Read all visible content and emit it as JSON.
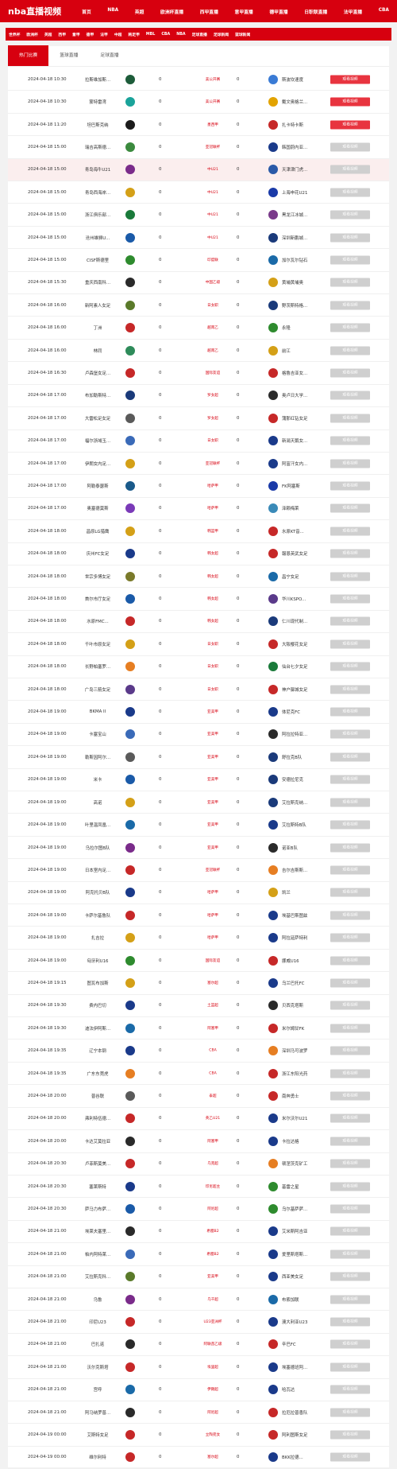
{
  "site": {
    "logo": "nba直播视频"
  },
  "topnav": [
    "首页",
    "NBA",
    "英超",
    "欧洲杯直播",
    "西甲直播",
    "意甲直播",
    "德甲直播",
    "日职联直播",
    "法甲直播",
    "CBA"
  ],
  "subnav": [
    "世界杯",
    "欧洲杯",
    "英超",
    "西甲",
    "意甲",
    "德甲",
    "法甲",
    "中超",
    "韩足甲",
    "MBL",
    "CBA",
    "NBA",
    "足球直播",
    "足球新闻",
    "篮球新闻"
  ],
  "tabs": [
    "热门比赛",
    "篮球直播",
    "足球直播"
  ],
  "colors": {
    "brand": "#d7000f",
    "live_button": "#e8343f",
    "disabled_button": "#cfcfcf"
  },
  "matches": [
    {
      "time": "2024-04-18 10:30",
      "home": "拉斯维加斯...",
      "home_score": "0",
      "league": "美公开赛",
      "away_score": "0",
      "away": "斯波坎速度",
      "button": "观看视频",
      "live": true,
      "hc": "#1d5c3a",
      "ac": "#3a7bd5"
    },
    {
      "time": "2024-04-18 10:30",
      "home": "蒙特雷湾",
      "home_score": "0",
      "league": "美公开赛",
      "away_score": "0",
      "away": "戴文奥格兰...",
      "button": "观看视频",
      "live": true,
      "hc": "#1aa39a",
      "ac": "#e2a300"
    },
    {
      "time": "2024-04-18 11:20",
      "home": "坦巴斯克纳",
      "home_score": "0",
      "league": "墨西甲",
      "away_score": "0",
      "away": "扎卡特卡斯",
      "button": "观看视频",
      "live": true,
      "hc": "#1b1b1b",
      "ac": "#c62828"
    },
    {
      "time": "2024-04-18 15:00",
      "home": "瑞吉高斯德...",
      "home_score": "0",
      "league": "亚冠联杯",
      "away_score": "0",
      "away": "韩国蔚内亚...",
      "button": "观看视频",
      "live": false,
      "hc": "#3b8a3e",
      "ac": "#1a3a8a"
    },
    {
      "time": "2024-04-18 15:00",
      "home": "青岛海牛U21",
      "home_score": "0",
      "league": "中U21",
      "away_score": "0",
      "away": "天津津门虎...",
      "button": "观看视频",
      "live": false,
      "hc": "#7a2b8a",
      "ac": "#2a5aa8",
      "hl": true
    },
    {
      "time": "2024-04-18 15:00",
      "home": "青岛西海岸...",
      "home_score": "0",
      "league": "中U21",
      "away_score": "0",
      "away": "上海申花U21",
      "button": "观看视频",
      "live": false,
      "hc": "#d4a017",
      "ac": "#1a3aa8"
    },
    {
      "time": "2024-04-18 15:00",
      "home": "浙江俱乐部...",
      "home_score": "0",
      "league": "中U21",
      "away_score": "0",
      "away": "黑龙江冰城...",
      "button": "观看视频",
      "live": false,
      "hc": "#1a7a3a",
      "ac": "#7a3a8a"
    },
    {
      "time": "2024-04-18 15:00",
      "home": "沧州雄狮U...",
      "home_score": "0",
      "league": "中U21",
      "away_score": "0",
      "away": "深圳新鹏城...",
      "button": "观看视频",
      "live": false,
      "hc": "#1a5aa8",
      "ac": "#1a3a7a"
    },
    {
      "time": "2024-04-18 15:00",
      "home": "CISF斯德里",
      "home_score": "0",
      "league": "印度联",
      "away_score": "0",
      "away": "加尔瓦尔钻石",
      "button": "观看视频",
      "live": false,
      "hc": "#2e8b2e",
      "ac": "#1a6aa8"
    },
    {
      "time": "2024-04-18 15:30",
      "home": "重庆西南科...",
      "home_score": "0",
      "league": "中国乙级",
      "away_score": "0",
      "away": "黄埔黄埔奥",
      "button": "观看视频",
      "live": false,
      "hc": "#2a2a2a",
      "ac": "#d4a017"
    },
    {
      "time": "2024-04-18 16:00",
      "home": "新阿素人女足",
      "home_score": "0",
      "league": "日女职",
      "away_score": "0",
      "away": "野茨斯特格...",
      "button": "观看视频",
      "live": false,
      "hc": "#5a7a2a",
      "ac": "#1a3a7a"
    },
    {
      "time": "2024-04-18 16:00",
      "home": "丁洲",
      "home_score": "0",
      "league": "越南乙",
      "away_score": "0",
      "away": "永隆",
      "button": "观看视频",
      "live": false,
      "hc": "#c62828",
      "ac": "#2e8b2e"
    },
    {
      "time": "2024-04-18 16:00",
      "home": "林同",
      "home_score": "0",
      "league": "越南乙",
      "away_score": "0",
      "away": "前江",
      "button": "观看视频",
      "live": false,
      "hc": "#2e8b5a",
      "ac": "#d4a017"
    },
    {
      "time": "2024-04-18 16:30",
      "home": "卢森堡女足...",
      "home_score": "0",
      "league": "国际友谊",
      "away_score": "0",
      "away": "格鲁吉亚女...",
      "button": "观看视频",
      "live": false,
      "hc": "#c62828",
      "ac": "#c62828"
    },
    {
      "time": "2024-04-18 17:00",
      "home": "布加勒斯特...",
      "home_score": "0",
      "league": "罗女超",
      "away_score": "0",
      "away": "奥卢日大学...",
      "button": "观看视频",
      "live": false,
      "hc": "#1a3a7a",
      "ac": "#2a2a2a"
    },
    {
      "time": "2024-04-18 17:00",
      "home": "大雷松足女足",
      "home_score": "0",
      "league": "罗女超",
      "away_score": "0",
      "away": "蒲那红钻女足",
      "button": "观看视频",
      "live": false,
      "hc": "#5a5a5a",
      "ac": "#c62828"
    },
    {
      "time": "2024-04-18 17:00",
      "home": "福尔浙域玉...",
      "home_score": "0",
      "league": "日女职",
      "away_score": "0",
      "away": "新潟天鹅女...",
      "button": "观看视频",
      "live": false,
      "hc": "#3a6ab8",
      "ac": "#1a3a8a"
    },
    {
      "time": "2024-04-18 17:00",
      "home": "伊朗女内足...",
      "home_score": "0",
      "league": "亚冠联杯",
      "away_score": "0",
      "away": "阿富汗女内...",
      "button": "观看视频",
      "live": false,
      "hc": "#d4a017",
      "ac": "#1a3a8a"
    },
    {
      "time": "2024-04-18 17:00",
      "home": "阿勒泰瑟斯",
      "home_score": "0",
      "league": "哈萨甲",
      "away_score": "0",
      "away": "FK阿塞斯",
      "button": "观看视频",
      "live": false,
      "hc": "#1a5a8a",
      "ac": "#1a3aa8"
    },
    {
      "time": "2024-04-18 17:00",
      "home": "奥塞德莫斯",
      "home_score": "0",
      "league": "哈萨甲",
      "away_score": "0",
      "away": "泽赖梅莱",
      "button": "观看视频",
      "live": false,
      "hc": "#7a3ab8",
      "ac": "#3a8ab8"
    },
    {
      "time": "2024-04-18 18:00",
      "home": "昌原LG猎鹰",
      "home_score": "0",
      "league": "韩篮甲",
      "away_score": "0",
      "away": "水原KT音...",
      "button": "观看视频",
      "live": false,
      "hc": "#d4a017",
      "ac": "#c62828"
    },
    {
      "time": "2024-04-18 18:00",
      "home": "庆州FC女足",
      "home_score": "0",
      "league": "韩女超",
      "away_score": "0",
      "away": "報恩英武女足",
      "button": "观看视频",
      "live": false,
      "hc": "#1a3a8a",
      "ac": "#c62828"
    },
    {
      "time": "2024-04-18 18:00",
      "home": "世宗多博女足",
      "home_score": "0",
      "league": "韩女超",
      "away_score": "0",
      "away": "昌宁女足",
      "button": "观看视频",
      "live": false,
      "hc": "#7a7a2a",
      "ac": "#1a6aa8"
    },
    {
      "time": "2024-04-18 18:00",
      "home": "首尔市厅女足",
      "home_score": "0",
      "league": "韩女超",
      "away_score": "0",
      "away": "华川KSPO...",
      "button": "观看视频",
      "live": false,
      "hc": "#1a5aa8",
      "ac": "#5a3a8a"
    },
    {
      "time": "2024-04-18 18:00",
      "home": "水原FMC...",
      "home_score": "0",
      "league": "韩女超",
      "away_score": "0",
      "away": "仁川现代制...",
      "button": "观看视频",
      "live": false,
      "hc": "#c62828",
      "ac": "#1a3a7a"
    },
    {
      "time": "2024-04-18 18:00",
      "home": "千叶市原女足",
      "home_score": "0",
      "league": "日女职",
      "away_score": "0",
      "away": "大阪樱花女足",
      "button": "观看视频",
      "live": false,
      "hc": "#d4a017",
      "ac": "#c62828"
    },
    {
      "time": "2024-04-18 18:00",
      "home": "长野帕塞罗...",
      "home_score": "0",
      "league": "日女职",
      "away_score": "0",
      "away": "仙台七夕女足",
      "button": "观看视频",
      "live": false,
      "hc": "#e67e22",
      "ac": "#1a7a3a"
    },
    {
      "time": "2024-04-18 18:00",
      "home": "广岛三箭女足",
      "home_score": "0",
      "league": "日女职",
      "away_score": "0",
      "away": "神户御城女足",
      "button": "观看视频",
      "live": false,
      "hc": "#5a3a8a",
      "ac": "#c62828"
    },
    {
      "time": "2024-04-18 19:00",
      "home": "BKMA II",
      "home_score": "0",
      "league": "亚美甲",
      "away_score": "0",
      "away": "体尼克FC",
      "button": "观看视频",
      "live": false,
      "hc": "#1a3a8a",
      "ac": "#1a3a8a"
    },
    {
      "time": "2024-04-18 19:00",
      "home": "卡塞宝山",
      "home_score": "0",
      "league": "亚美甲",
      "away_score": "0",
      "away": "阿拉拉特亚...",
      "button": "观看视频",
      "live": false,
      "hc": "#3a6ab8",
      "ac": "#2a2a2a"
    },
    {
      "time": "2024-04-18 19:00",
      "home": "勒斯因阿尔...",
      "home_score": "0",
      "league": "亚美甲",
      "away_score": "0",
      "away": "舒拉克B队",
      "button": "观看视频",
      "live": false,
      "hc": "#5a5a5a",
      "ac": "#1a3a7a"
    },
    {
      "time": "2024-04-18 19:00",
      "home": "米卡",
      "home_score": "0",
      "league": "亚美甲",
      "away_score": "0",
      "away": "安德拉尼克",
      "button": "观看视频",
      "live": false,
      "hc": "#1a5aa8",
      "ac": "#1a3a7a"
    },
    {
      "time": "2024-04-18 19:00",
      "home": "高诺",
      "home_score": "0",
      "league": "亚美甲",
      "away_score": "0",
      "away": "艾拉斯克纳...",
      "button": "观看视频",
      "live": false,
      "hc": "#d4a017",
      "ac": "#1a3a7a"
    },
    {
      "time": "2024-04-18 19:00",
      "home": "叶里温凤凰...",
      "home_score": "0",
      "league": "亚美甲",
      "away_score": "0",
      "away": "艾拉斯特B队",
      "button": "观看视频",
      "live": false,
      "hc": "#1a6aa8",
      "ac": "#1a3a8a"
    },
    {
      "time": "2024-04-18 19:00",
      "home": "乌拉尔图B队",
      "home_score": "0",
      "league": "亚美甲",
      "away_score": "0",
      "away": "诺亚B队",
      "button": "观看视频",
      "live": false,
      "hc": "#7a2b8a",
      "ac": "#2a2a2a"
    },
    {
      "time": "2024-04-18 19:00",
      "home": "日本室内足...",
      "home_score": "0",
      "league": "亚冠联杯",
      "away_score": "0",
      "away": "吉尔吉斯斯...",
      "button": "观看视频",
      "live": false,
      "hc": "#c62828",
      "ac": "#e67e22"
    },
    {
      "time": "2024-04-18 19:00",
      "home": "阿克托贝B队",
      "home_score": "0",
      "league": "哈萨甲",
      "away_score": "0",
      "away": "凯兰",
      "button": "观看视频",
      "live": false,
      "hc": "#1a3a8a",
      "ac": "#d4a017"
    },
    {
      "time": "2024-04-18 19:00",
      "home": "卡萨尔基鲁队",
      "home_score": "0",
      "league": "哈萨甲",
      "away_score": "0",
      "away": "埃基巴斯图兹",
      "button": "观看视频",
      "live": false,
      "hc": "#c62828",
      "ac": "#1a3a8a"
    },
    {
      "time": "2024-04-18 19:00",
      "home": "扎吉拉",
      "home_score": "0",
      "league": "哈萨甲",
      "away_score": "0",
      "away": "阿拉延萨特利",
      "button": "观看视频",
      "live": false,
      "hc": "#d4a017",
      "ac": "#1a3a8a"
    },
    {
      "time": "2024-04-18 19:00",
      "home": "匈牙利U16",
      "home_score": "0",
      "league": "国际友谊",
      "away_score": "0",
      "away": "挪威U16",
      "button": "观看视频",
      "live": false,
      "hc": "#2e8b2e",
      "ac": "#c62828"
    },
    {
      "time": "2024-04-18 19:15",
      "home": "图瓦布加斯",
      "home_score": "0",
      "league": "塞尔超",
      "away_score": "0",
      "away": "乌兰巴托FC",
      "button": "观看视频",
      "live": false,
      "hc": "#d4a017",
      "ac": "#1a3a8a"
    },
    {
      "time": "2024-04-18 19:30",
      "home": "费内巴切",
      "home_score": "0",
      "league": "土篮超",
      "away_score": "0",
      "away": "贝西克塔斯",
      "button": "观看视频",
      "live": false,
      "hc": "#1a3a8a",
      "ac": "#2a2a2a"
    },
    {
      "time": "2024-04-18 19:30",
      "home": "迪法伊阿斯...",
      "home_score": "0",
      "league": "阿塞甲",
      "away_score": "0",
      "away": "米尔姆甘FK",
      "button": "观看视频",
      "live": false,
      "hc": "#1a6aa8",
      "ac": "#c62828"
    },
    {
      "time": "2024-04-18 19:35",
      "home": "辽宁本钢",
      "home_score": "0",
      "league": "CBA",
      "away_score": "0",
      "away": "深圳马可波罗",
      "button": "观看视频",
      "live": false,
      "hc": "#1a3a8a",
      "ac": "#e67e22"
    },
    {
      "time": "2024-04-18 19:35",
      "home": "广东东莞虎",
      "home_score": "0",
      "league": "CBA",
      "away_score": "0",
      "away": "浙江东阳光药",
      "button": "观看视频",
      "live": false,
      "hc": "#e67e22",
      "ac": "#c62828"
    },
    {
      "time": "2024-04-18 20:00",
      "home": "普谷联",
      "home_score": "0",
      "league": "泰超",
      "away_score": "0",
      "away": "南奔勇士",
      "button": "观看视频",
      "live": false,
      "hc": "#5a5a5a",
      "ac": "#c62828"
    },
    {
      "time": "2024-04-18 20:00",
      "home": "弗利特伍德...",
      "home_score": "0",
      "league": "英乙U21",
      "away_score": "0",
      "away": "米尔沃尔U21",
      "button": "观看视频",
      "live": false,
      "hc": "#c62828",
      "ac": "#1a3a8a"
    },
    {
      "time": "2024-04-18 20:00",
      "home": "卡达艾莫拉亚",
      "home_score": "0",
      "league": "阿塞甲",
      "away_score": "0",
      "away": "卡拉达格",
      "button": "观看视频",
      "live": false,
      "hc": "#2a2a2a",
      "ac": "#1a3a8a"
    },
    {
      "time": "2024-04-18 20:30",
      "home": "卢菲斯莫美...",
      "home_score": "0",
      "league": "乌克超",
      "away_score": "0",
      "away": "顿涅茨克矿工",
      "button": "观看视频",
      "live": false,
      "hc": "#c62828",
      "ac": "#e67e22"
    },
    {
      "time": "2024-04-18 20:30",
      "home": "塞莱斯特",
      "home_score": "0",
      "league": "印尼超主",
      "away_score": "0",
      "away": "基雷之星",
      "button": "观看视频",
      "live": false,
      "hc": "#1a3a8a",
      "ac": "#2e8b2e"
    },
    {
      "time": "2024-04-18 20:30",
      "home": "萨马力布萨...",
      "home_score": "0",
      "league": "阿尼超",
      "away_score": "0",
      "away": "乌尔基萨萨...",
      "button": "观看视频",
      "live": false,
      "hc": "#1a5aa8",
      "ac": "#2e8b2e"
    },
    {
      "time": "2024-04-18 21:00",
      "home": "埃莱夫塞里...",
      "home_score": "0",
      "league": "希腊B2",
      "away_score": "0",
      "away": "艾米斯阿吉亚",
      "button": "观看视频",
      "live": false,
      "hc": "#2a2a2a",
      "ac": "#1a3a8a"
    },
    {
      "time": "2024-04-18 21:00",
      "home": "帕内阿特莱...",
      "home_score": "0",
      "league": "希腊B2",
      "away_score": "0",
      "away": "爱里斯塔斯...",
      "button": "观看视频",
      "live": false,
      "hc": "#3a6ab8",
      "ac": "#1a3a8a"
    },
    {
      "time": "2024-04-18 21:00",
      "home": "艾拉斯克科...",
      "home_score": "0",
      "league": "亚美甲",
      "away_score": "0",
      "away": "西亚美女足",
      "button": "观看视频",
      "live": false,
      "hc": "#5a7a2a",
      "ac": "#1a3a8a"
    },
    {
      "time": "2024-04-18 21:00",
      "home": "乌鲁",
      "home_score": "0",
      "league": "乌干超",
      "away_score": "0",
      "away": "布索加联",
      "button": "观看视频",
      "live": false,
      "hc": "#7a2b8a",
      "ac": "#1a6aa8"
    },
    {
      "time": "2024-04-18 21:00",
      "home": "印尼U23",
      "home_score": "0",
      "league": "U23亚洲杯",
      "away_score": "0",
      "away": "澳大利亚U23",
      "button": "观看视频",
      "live": false,
      "hc": "#c62828",
      "ac": "#1a3a8a"
    },
    {
      "time": "2024-04-18 21:00",
      "home": "巴扎诺",
      "home_score": "0",
      "league": "阿联酋乙级",
      "away_score": "0",
      "away": "辛巴FC",
      "button": "观看视频",
      "live": false,
      "hc": "#2a2a2a",
      "ac": "#c62828"
    },
    {
      "time": "2024-04-18 21:00",
      "home": "沃尔克斯塔",
      "home_score": "0",
      "league": "埃里超",
      "away_score": "0",
      "away": "埃塞德班阿...",
      "button": "观看视频",
      "live": false,
      "hc": "#c62828",
      "ac": "#1a3a8a"
    },
    {
      "time": "2024-04-18 21:00",
      "home": "宫呼",
      "home_score": "0",
      "league": "伊朗超",
      "away_score": "0",
      "away": "哈瓦达",
      "button": "观看视频",
      "live": false,
      "hc": "#1a6aa8",
      "ac": "#1a3a8a"
    },
    {
      "time": "2024-04-18 21:00",
      "home": "阿马纳罗普...",
      "home_score": "0",
      "league": "阿尼超",
      "away_score": "0",
      "away": "拉厄拉普香队",
      "button": "观看视频",
      "live": false,
      "hc": "#2a2a2a",
      "ac": "#c62828"
    },
    {
      "time": "2024-04-19 00:00",
      "home": "艾斯特女足",
      "home_score": "0",
      "league": "立陶宛女",
      "away_score": "0",
      "away": "阿利图斯女足",
      "button": "观看视频",
      "live": false,
      "hc": "#c62828",
      "ac": "#c62828"
    },
    {
      "time": "2024-04-19 00:00",
      "home": "维尔利特",
      "home_score": "0",
      "league": "塞尔超",
      "away_score": "0",
      "away": "BKK拉德...",
      "button": "观看视频",
      "live": false,
      "hc": "#c62828",
      "ac": "#1a3a8a"
    }
  ]
}
